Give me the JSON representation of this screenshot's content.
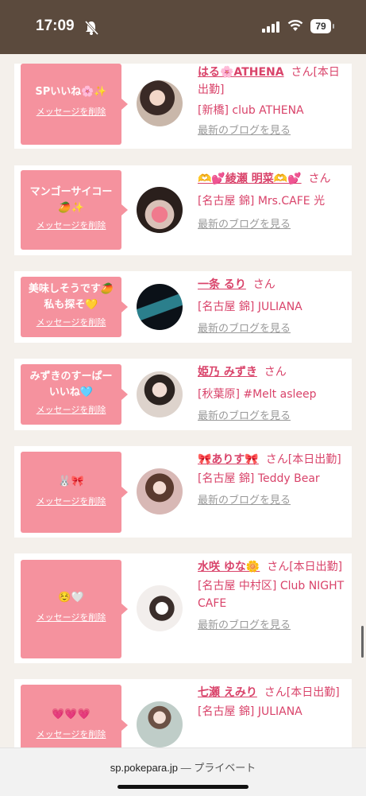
{
  "status": {
    "time": "17:09",
    "battery": "79"
  },
  "feed": [
    {
      "msg1": "SPいいね🌸✨",
      "msg2": "",
      "delete": "メッセージを削除",
      "name": "はる🌸ATHENA",
      "san": "さん",
      "tag": "[本日出勤]",
      "shop": "[新橋] club ATHENA",
      "blog": "最新のブログを見る"
    },
    {
      "msg1": "マンゴーサイコー",
      "msg2": "🥭✨",
      "delete": "メッセージを削除",
      "name": "🫶💕綾瀬 明菜🫶💕",
      "san": "さん",
      "tag": "",
      "shop": "[名古屋 錦] Mrs.CAFE 光",
      "blog": "最新のブログを見る"
    },
    {
      "msg1": "美味しそうです🥭",
      "msg2": "私も探そ💛",
      "delete": "メッセージを削除",
      "name": "一条 るり",
      "san": "さん",
      "tag": "",
      "shop": "[名古屋 錦] JULIANA",
      "blog": "最新のブログを見る"
    },
    {
      "msg1": "みずきのすーぱー",
      "msg2": "いいね🩵",
      "delete": "メッセージを削除",
      "name": "姫乃 みずき",
      "san": "さん",
      "tag": "",
      "shop": "[秋葉原] #Melt asleep",
      "blog": "最新のブログを見る"
    },
    {
      "msg1": "🐰🎀",
      "msg2": "",
      "delete": "メッセージを削除",
      "name": "🎀ありす🎀",
      "san": "さん",
      "tag": "[本日出勤]",
      "shop": "[名古屋 錦] Teddy Bear",
      "blog": "最新のブログを見る"
    },
    {
      "msg1": "☺️🤍",
      "msg2": "",
      "delete": "メッセージを削除",
      "name": "水咲 ゆな🌼",
      "san": "さん",
      "tag": "[本日出勤]",
      "shop": "[名古屋 中村区] Club NIGHT CAFE",
      "blog": "最新のブログを見る"
    },
    {
      "msg1": "💗💗💗",
      "msg2": "",
      "delete": "メッセージを削除",
      "name": "七瀬 えみり",
      "san": "さん",
      "tag": "[本日出勤]",
      "shop": "[名古屋 錦] JULIANA",
      "blog": ""
    }
  ],
  "browser": {
    "url": "sp.pokepara.jp",
    "mode": "— プライベート"
  },
  "colors": {
    "accent": "#d9436a",
    "bubble": "#f5929e",
    "statusbar": "#5b4a3d"
  }
}
